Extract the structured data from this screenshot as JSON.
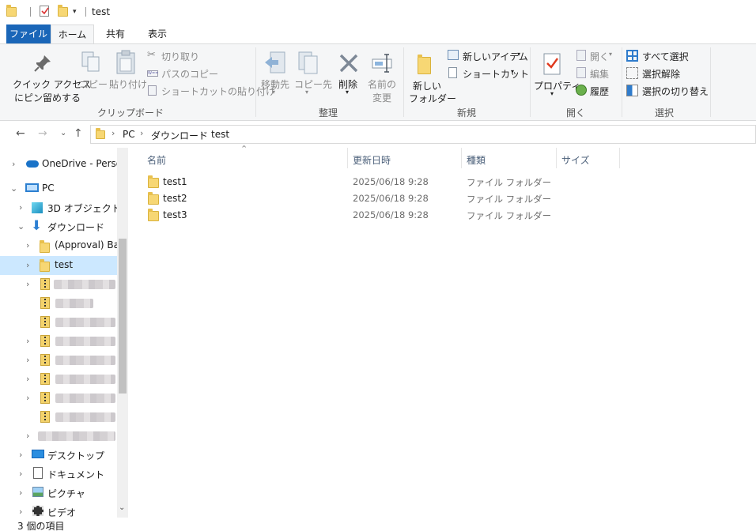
{
  "window": {
    "title": "test"
  },
  "ribbon_tabs": [
    {
      "label": "ファイル"
    },
    {
      "label": "ホーム"
    },
    {
      "label": "共有"
    },
    {
      "label": "表示"
    }
  ],
  "ribbon": {
    "clipboard": {
      "quick_access_line1": "クイック アクセス",
      "quick_access_line2": "にピン留めする",
      "copy": "コピー",
      "paste": "貼り付け",
      "cut": "切り取り",
      "copy_path": "パスのコピー",
      "paste_shortcut": "ショートカットの貼り付け",
      "group": "クリップボード"
    },
    "organize": {
      "move_to": "移動先",
      "copy_to": "コピー先",
      "delete": "削除",
      "rename_line1": "名前の",
      "rename_line2": "変更",
      "group": "整理"
    },
    "new": {
      "new_folder_line1": "新しい",
      "new_folder_line2": "フォルダー",
      "new_item": "新しいアイテム",
      "shortcut": "ショートカット",
      "group": "新規"
    },
    "open": {
      "properties": "プロパティ",
      "open": "開く",
      "edit": "編集",
      "history": "履歴",
      "group": "開く"
    },
    "select": {
      "select_all": "すべて選択",
      "select_none": "選択解除",
      "invert": "選択の切り替え",
      "group": "選択"
    }
  },
  "address": {
    "crumbs": [
      "PC",
      "ダウンロード",
      "test"
    ]
  },
  "nav": {
    "onedrive": "OneDrive - Personal",
    "pc": "PC",
    "objects3d": "3D オブジェクト",
    "downloads": "ダウンロード",
    "approval": "(Approval) Band",
    "test": "test",
    "desktop": "デスクトップ",
    "documents": "ドキュメント",
    "pictures": "ピクチャ",
    "videos": "ビデオ"
  },
  "columns": {
    "name": "名前",
    "date": "更新日時",
    "type": "種類",
    "size": "サイズ"
  },
  "files": [
    {
      "name": "test1",
      "date": "2025/06/18 9:28",
      "type": "ファイル フォルダー"
    },
    {
      "name": "test2",
      "date": "2025/06/18 9:28",
      "type": "ファイル フォルダー"
    },
    {
      "name": "test3",
      "date": "2025/06/18 9:28",
      "type": "ファイル フォルダー"
    }
  ],
  "status": {
    "count": "3 個の項目"
  },
  "icons": {
    "folder": "folder-icon",
    "pin": "pin-icon",
    "delete": "delete-x-icon",
    "properties": "properties-check-icon",
    "zip": "zip-folder-icon"
  },
  "colors": {
    "file_tab": "#1a66b8",
    "selection": "#cce8ff",
    "folder": "#f7d774"
  }
}
